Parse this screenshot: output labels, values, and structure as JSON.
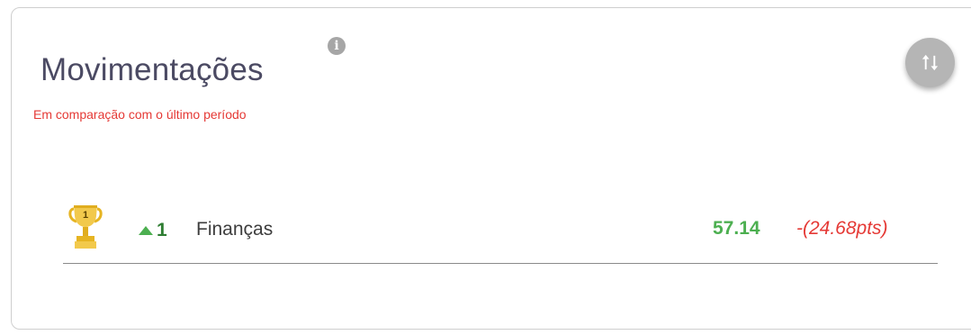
{
  "header": {
    "title": "Movimentações",
    "subtitle": "Em comparação com o último período",
    "info_icon": "info-icon",
    "info_glyph": "i",
    "sort_icon": "swap-vertical-icon"
  },
  "ranking": [
    {
      "position": "1",
      "icon": "trophy-icon",
      "change_direction": "up",
      "change_value": "1",
      "name": "Finanças",
      "score": "57.14",
      "delta": "-(24.68pts)"
    }
  ],
  "colors": {
    "title": "#4b4a63",
    "subtitle": "#e53935",
    "positive": "#4caf50",
    "negative": "#e53935",
    "trophy_gold": "#e6b422",
    "button_gray": "#b5b5b5"
  }
}
